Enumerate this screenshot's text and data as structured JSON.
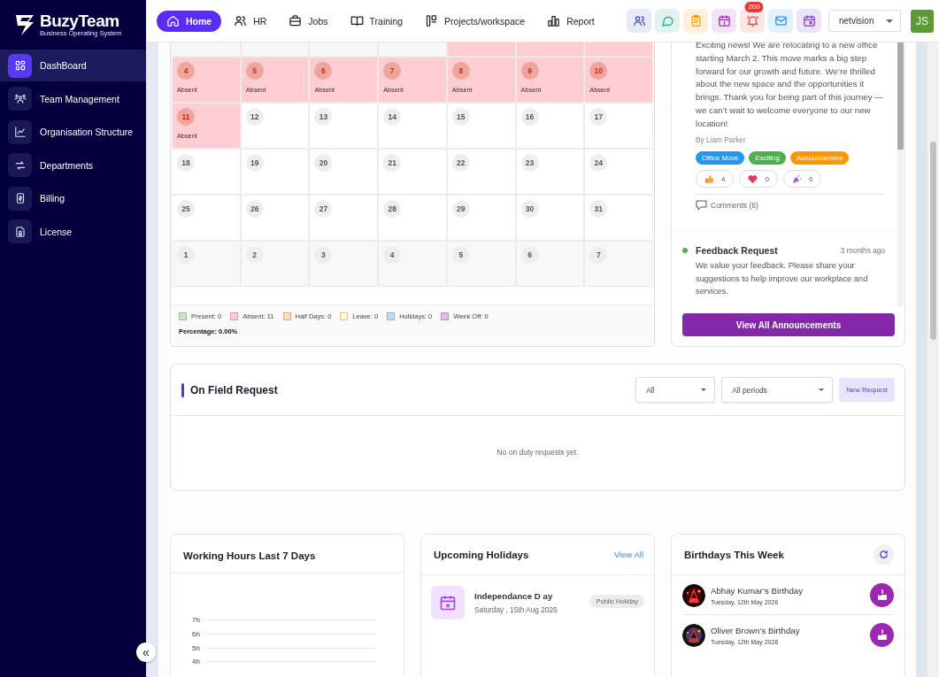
{
  "sidebar": {
    "logo": "BuzyTeam",
    "tagline": "Business Operating System",
    "collapse": "«",
    "items": [
      {
        "label": "DashBoard",
        "selected": true
      },
      {
        "label": "Team Management",
        "selected": false
      },
      {
        "label": "Organisation Structure",
        "selected": false
      },
      {
        "label": "Departments",
        "selected": false
      },
      {
        "label": "Billing",
        "selected": false
      },
      {
        "label": "License",
        "selected": false
      }
    ]
  },
  "header": {
    "nav": [
      {
        "label": "Home",
        "selected": true
      },
      {
        "label": "HR",
        "selected": false
      },
      {
        "label": "Jobs",
        "selected": false
      },
      {
        "label": "Training",
        "selected": false
      },
      {
        "label": "Projects/workspace",
        "selected": false
      },
      {
        "label": "Report",
        "selected": false
      }
    ],
    "notification_badge": "200",
    "company": "netvision",
    "avatar": "JS"
  },
  "calendar": {
    "weeks": [
      [
        {
          "kind": "other"
        },
        {
          "kind": "other"
        },
        {
          "kind": "other"
        },
        {
          "kind": "other"
        },
        {
          "kind": "absent"
        },
        {
          "kind": "absent"
        },
        {
          "kind": "absent"
        }
      ],
      [
        {
          "day": "4",
          "kind": "absent",
          "note": "Absent"
        },
        {
          "day": "5",
          "kind": "absent",
          "note": "Absent"
        },
        {
          "day": "6",
          "kind": "absent",
          "note": "Absent"
        },
        {
          "day": "7",
          "kind": "absent",
          "note": "Absent"
        },
        {
          "day": "8",
          "kind": "absent",
          "note": "Absent"
        },
        {
          "day": "9",
          "kind": "absent",
          "note": "Absent"
        },
        {
          "day": "10",
          "kind": "absent",
          "note": "Absent"
        }
      ],
      [
        {
          "day": "11",
          "kind": "absent",
          "note": "Absent"
        },
        {
          "day": "12",
          "kind": "plain"
        },
        {
          "day": "13",
          "kind": "plain"
        },
        {
          "day": "14",
          "kind": "plain"
        },
        {
          "day": "15",
          "kind": "plain"
        },
        {
          "day": "16",
          "kind": "plain"
        },
        {
          "day": "17",
          "kind": "plain"
        }
      ],
      [
        {
          "day": "18",
          "kind": "plain"
        },
        {
          "day": "19",
          "kind": "plain"
        },
        {
          "day": "20",
          "kind": "plain"
        },
        {
          "day": "21",
          "kind": "plain"
        },
        {
          "day": "22",
          "kind": "plain"
        },
        {
          "day": "23",
          "kind": "plain"
        },
        {
          "day": "24",
          "kind": "plain"
        }
      ],
      [
        {
          "day": "25",
          "kind": "plain"
        },
        {
          "day": "26",
          "kind": "plain"
        },
        {
          "day": "27",
          "kind": "plain"
        },
        {
          "day": "28",
          "kind": "plain"
        },
        {
          "day": "29",
          "kind": "plain"
        },
        {
          "day": "30",
          "kind": "plain"
        },
        {
          "day": "31",
          "kind": "plain"
        }
      ],
      [
        {
          "day": "1",
          "kind": "other"
        },
        {
          "day": "2",
          "kind": "other"
        },
        {
          "day": "3",
          "kind": "other"
        },
        {
          "day": "4",
          "kind": "other"
        },
        {
          "day": "5",
          "kind": "other"
        },
        {
          "day": "6",
          "kind": "other"
        },
        {
          "day": "7",
          "kind": "other"
        }
      ]
    ],
    "legend": [
      {
        "label": "Present: 0",
        "color": "#c8e6c9"
      },
      {
        "label": "Absent: 11",
        "color": "#ffcdd2"
      },
      {
        "label": "Half Days: 0",
        "color": "#ffe0b2"
      },
      {
        "label": "Leave: 0",
        "color": "#fff9c4"
      },
      {
        "label": "Holidays: 0",
        "color": "#bbdefb"
      },
      {
        "label": "Week Off: 0",
        "color": "#e1bee7"
      }
    ],
    "percentage": "Percentage: 0.00%"
  },
  "announcements": {
    "items": [
      {
        "body": "Exciting news! We are relocating to a new office starting March 2. This move marks a big step forward for our growth and future. We’re thrilled about the new space and the opportunities it brings. Thank you for being part of this journey — we can’t wait to welcome everyone to our new location!",
        "author": "By Liam Parker",
        "tags": [
          {
            "label": "Office Move",
            "color": "#2196f3"
          },
          {
            "label": "Exciting",
            "color": "#4caf50"
          },
          {
            "label": "Announcement",
            "color": "#ff9800"
          }
        ],
        "reactions": [
          {
            "count": "4"
          },
          {
            "count": "0"
          },
          {
            "count": "0"
          }
        ],
        "comments": "Comments (6)"
      },
      {
        "title": "Feedback Request",
        "time": "3 months ago",
        "color": "#4caf50",
        "body": "We value your feedback. Please share your suggestions to help improve our workplace and services."
      }
    ],
    "button": "View All Announcements"
  },
  "field_request": {
    "title": "On Field Request",
    "filters": [
      "All",
      "All periods"
    ],
    "button": "New Request",
    "empty": "No on duty requests yet."
  },
  "working_hours": {
    "title": "Working Hours Last 7 Days",
    "y_labels": [
      "7h",
      "6h",
      "5h",
      "4h"
    ]
  },
  "holidays": {
    "title": "Upcoming Holidays",
    "link": "View All",
    "items": [
      {
        "name": "Independance D ay",
        "date": "Saturday , 15th Aug 2026",
        "tag": "Public Holiday"
      }
    ]
  },
  "birthdays": {
    "title": "Birthdays This Week",
    "items": [
      {
        "name": "Abhay Kumar’s Birthday",
        "date": "Tuesday, 12th May 2026"
      },
      {
        "name": "Oliver Brown’s Birthday",
        "date": "Tuesday, 12th May 2026"
      }
    ]
  }
}
